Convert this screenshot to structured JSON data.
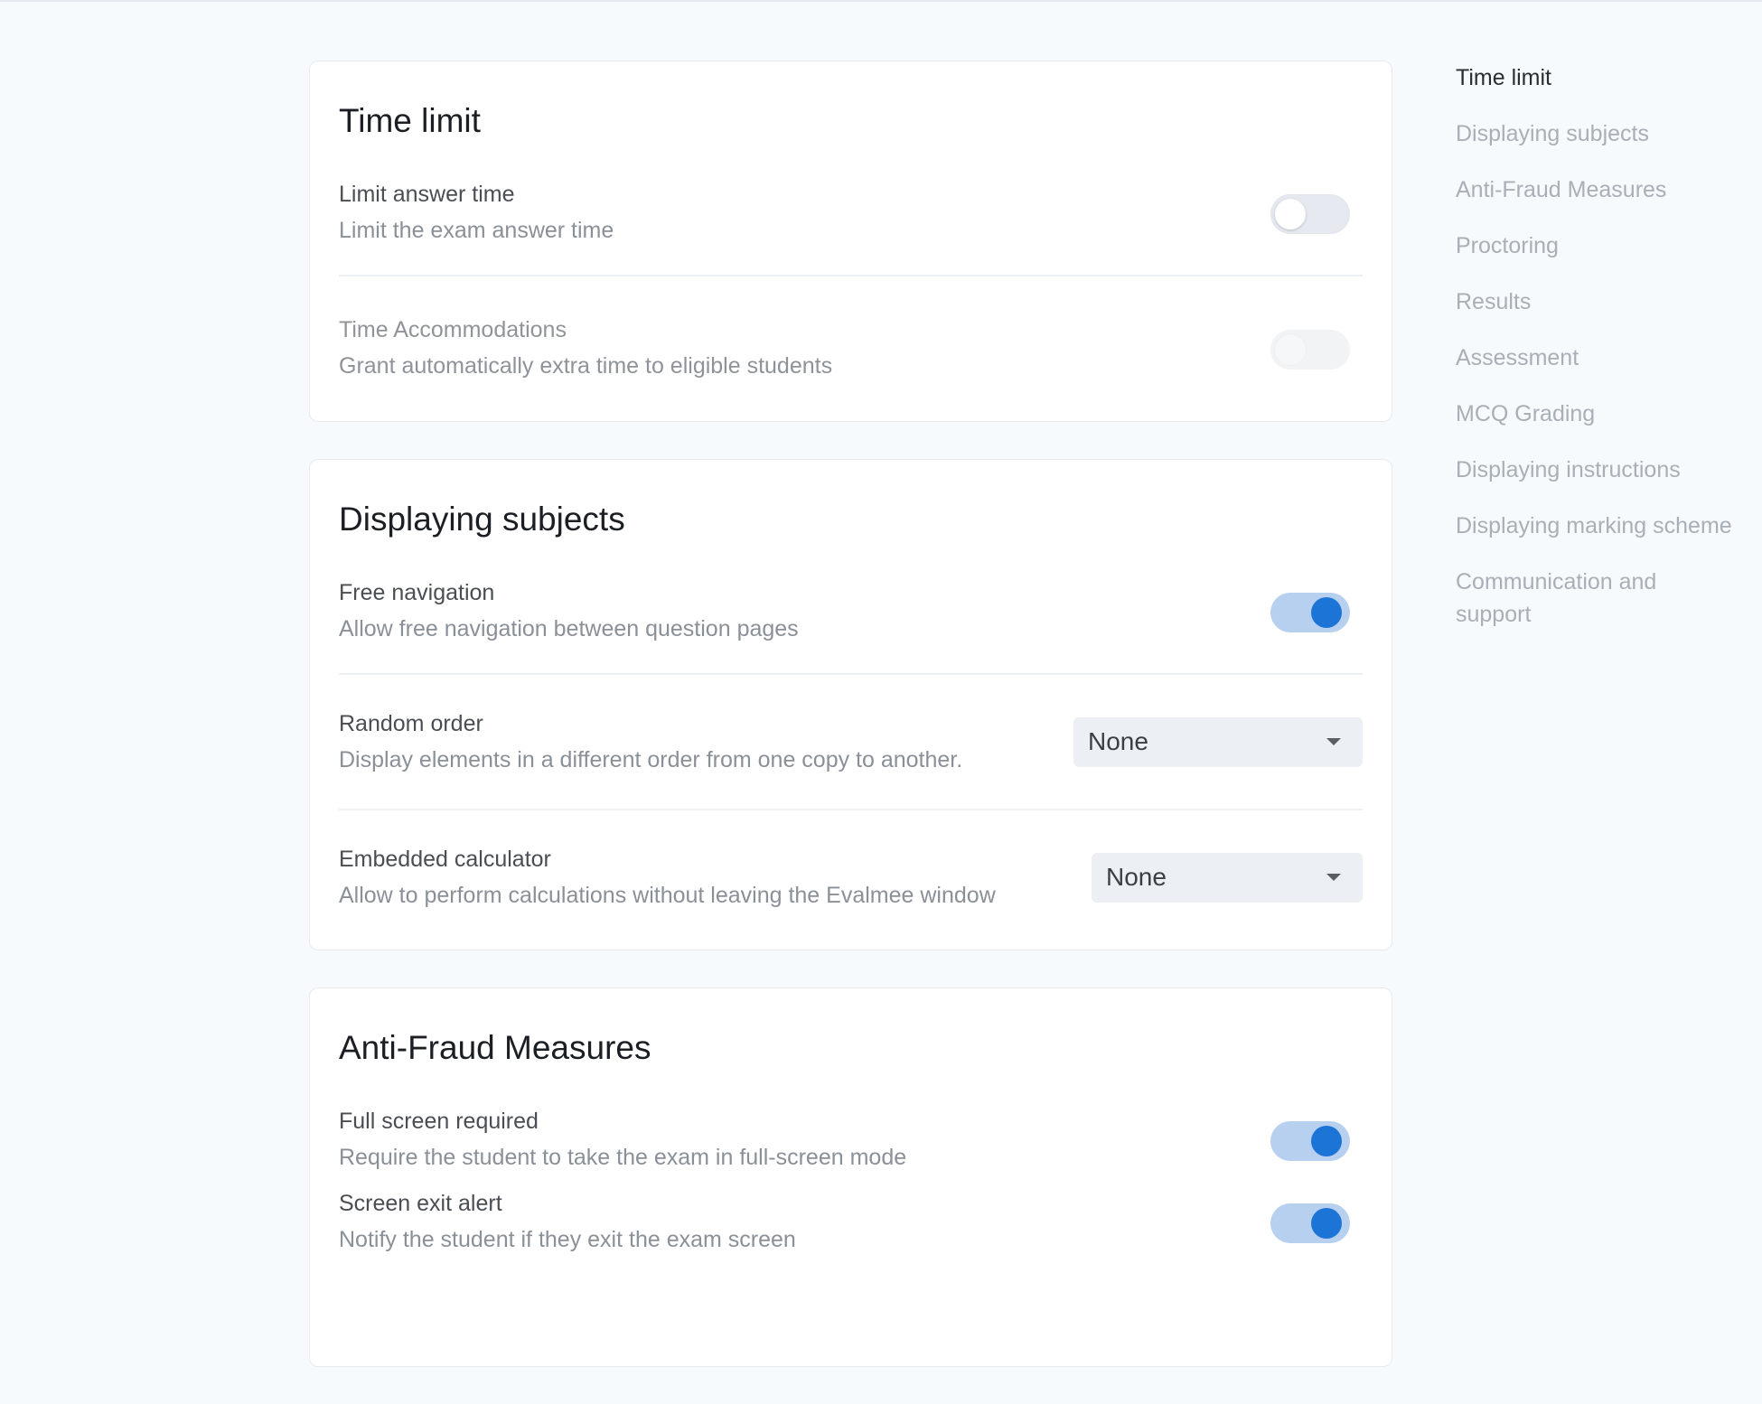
{
  "sections": {
    "time_limit": {
      "title": "Time limit",
      "limit_answer_time": {
        "label": "Limit answer time",
        "description": "Limit the exam answer time",
        "enabled": false
      },
      "time_accommodations": {
        "label": "Time Accommodations",
        "description": "Grant automatically extra time to eligible students",
        "enabled": false,
        "disabled": true
      }
    },
    "displaying_subjects": {
      "title": "Displaying subjects",
      "free_navigation": {
        "label": "Free navigation",
        "description": "Allow free navigation between question pages",
        "enabled": true
      },
      "random_order": {
        "label": "Random order",
        "description": "Display elements in a different order from one copy to another.",
        "selected": "None"
      },
      "embedded_calculator": {
        "label": "Embedded calculator",
        "description": "Allow to perform calculations without leaving the Evalmee window",
        "selected": "None"
      }
    },
    "anti_fraud": {
      "title": "Anti-Fraud Measures",
      "full_screen_required": {
        "label": "Full screen required",
        "description": "Require the student to take the exam in full-screen mode",
        "enabled": true
      },
      "screen_exit_alert": {
        "label": "Screen exit alert",
        "description": "Notify the student if they exit the exam screen",
        "enabled": true
      }
    }
  },
  "toc": {
    "active": "Time limit",
    "items": [
      "Time limit",
      "Displaying subjects",
      "Anti-Fraud Measures",
      "Proctoring",
      "Results",
      "Assessment",
      "MCQ Grading",
      "Displaying instructions",
      "Displaying marking scheme",
      "Communication and support"
    ]
  },
  "colors": {
    "accent": "#1b74d6",
    "toggle_track_on": "#b7d0ef",
    "toggle_track_off": "#e6e9f0",
    "page_background": "#f7fafd"
  }
}
